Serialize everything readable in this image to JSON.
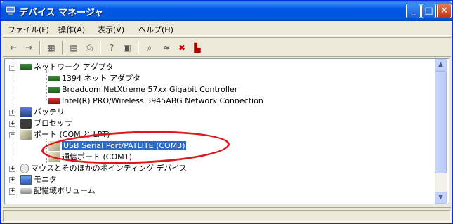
{
  "window": {
    "title": "デバイス マネージャ",
    "buttons": {
      "minimize": "_",
      "maximize": "□",
      "close": "✕"
    }
  },
  "menu": [
    {
      "label": "ファイル(F)"
    },
    {
      "label": "操作(A)"
    },
    {
      "label": "表示(V)"
    },
    {
      "label": "ヘルプ(H)"
    }
  ],
  "toolbar": {
    "icons": [
      "back-arrow-icon",
      "forward-arrow-icon",
      "view-icon",
      "properties-icon",
      "print-icon",
      "help-icon",
      "view2-icon",
      "scan-hardware-icon",
      "update-driver-icon",
      "disable-icon",
      "uninstall-icon"
    ]
  },
  "tree": {
    "network_adapters": "ネットワーク アダプタ",
    "adapter_1394": "1394 ネット アダプタ",
    "adapter_broadcom": "Broadcom NetXtreme 57xx Gigabit Controller",
    "adapter_intel": "Intel(R) PRO/Wireless 3945ABG Network Connection",
    "battery": "バッテリ",
    "processor": "プロセッサ",
    "ports": "ポート (COM と LPT)",
    "port_usb": "USB Serial Port/PATLITE (COM3)",
    "port_com1": "通信ポート (COM1)",
    "mouse": "マウスとそのほかのポインティング デバイス",
    "monitor": "モニタ",
    "storage": "記憶域ボリューム"
  },
  "highlight_color": "#e3141b",
  "selection_color": "#316ac5"
}
